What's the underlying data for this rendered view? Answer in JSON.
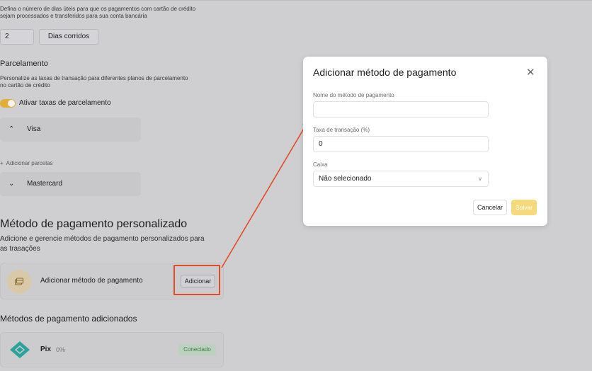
{
  "payout": {
    "description": "Defina o número de dias úteis para que os pagamentos com cartão de crédito sejam processados e transferidos para sua conta bancária",
    "days_value": "2",
    "days_unit": "Dias corridos"
  },
  "installments": {
    "title": "Parcelamento",
    "description": "Personalize as taxas de transação para diferentes planos de parcelamento no cartão de crédito",
    "toggle_label": "Ativar taxas de parcelamento",
    "toggle_on": true,
    "visa_label": "Visa",
    "add_installments_label": "Adicionar parcelas",
    "mastercard_label": "Mastercard"
  },
  "custom_methods": {
    "title": "Método de pagamento personalizado",
    "description": "Adicione e gerencie métodos de pagamento personalizados para as trasações",
    "add_card_label": "Adicionar método de pagamento",
    "add_button_label": "Adicionar"
  },
  "added_methods": {
    "title": "Métodos de pagamento adicionados",
    "items": [
      {
        "name": "Pix",
        "rate": "0%",
        "status": "Conectado"
      }
    ]
  },
  "modal": {
    "title": "Adicionar método de pagamento",
    "name_label": "Nome do método de pagamento",
    "name_value": "",
    "rate_label": "Taxa de transação (%)",
    "rate_value": "0",
    "cashier_label": "Caixa",
    "cashier_value": "Não selecionado",
    "cancel_label": "Cancelar",
    "save_label": "Salvar"
  },
  "colors": {
    "accent": "#e3ad3c",
    "annotation": "#e34a2b",
    "save_button": "#f5d97a",
    "connected_badge": "#bcd1bf",
    "pix_brand": "#2aa39a"
  }
}
